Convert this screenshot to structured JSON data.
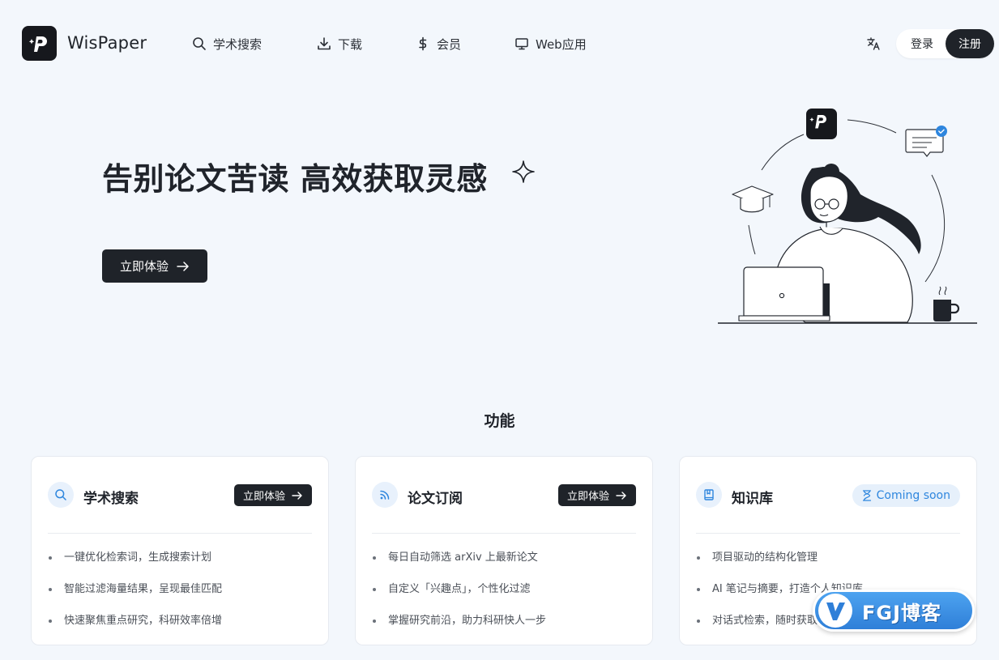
{
  "brand": {
    "name": "WisPaper"
  },
  "nav": [
    {
      "label": "学术搜索",
      "icon": "search-icon"
    },
    {
      "label": "下载",
      "icon": "download-icon"
    },
    {
      "label": "会员",
      "icon": "dollar-icon"
    },
    {
      "label": "Web应用",
      "icon": "monitor-icon"
    }
  ],
  "header": {
    "translate_icon": "translate-icon",
    "login_label": "登录",
    "register_label": "注册"
  },
  "hero": {
    "title": "告别论文苦读 高效获取灵感",
    "cta_label": "立即体验"
  },
  "features": {
    "title": "功能",
    "cards": [
      {
        "title": "学术搜索",
        "icon": "search-icon",
        "action_label": "立即体验",
        "items": [
          "一键优化检索词，生成搜索计划",
          "智能过滤海量结果，呈现最佳匹配",
          "快速聚焦重点研究，科研效率倍增"
        ]
      },
      {
        "title": "论文订阅",
        "icon": "rss-icon",
        "action_label": "立即体验",
        "items": [
          "每日自动筛选 arXiv 上最新论文",
          "自定义「兴趣点」，个性化过滤",
          "掌握研究前沿，助力科研快人一步"
        ]
      },
      {
        "title": "知识库",
        "icon": "book-icon",
        "badge_label": "Coming soon",
        "items": [
          "项目驱动的结构化管理",
          "AI 笔记与摘要，打造个人知识库",
          "对话式检索，随时获取"
        ]
      }
    ]
  },
  "watermark": {
    "text": "FGJ博客"
  },
  "colors": {
    "primary_dark": "#1f2329",
    "accent_blue": "#2e86de",
    "page_bg": "#f3f7fc"
  }
}
